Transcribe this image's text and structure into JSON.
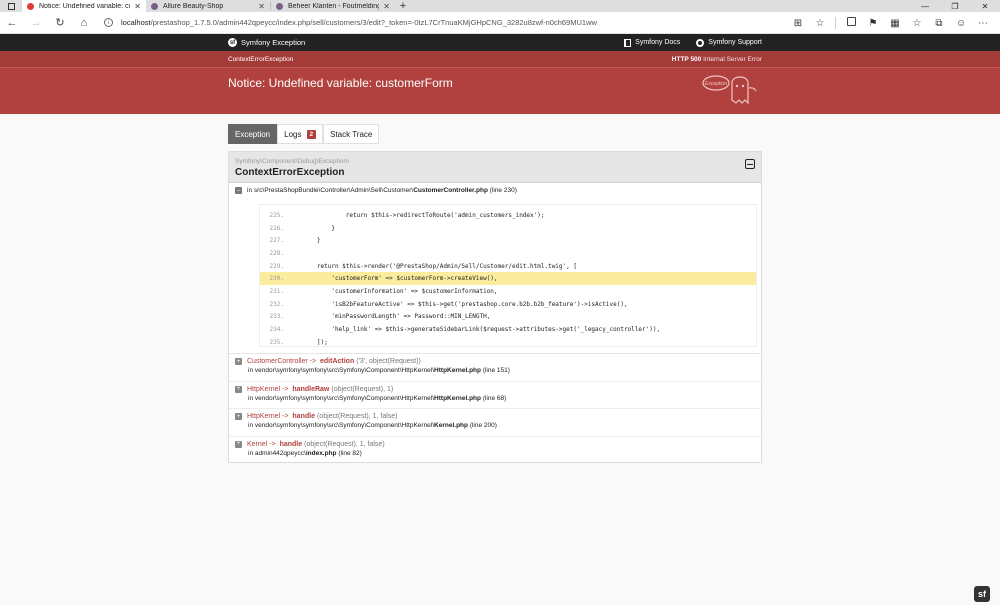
{
  "browser": {
    "tabs": [
      {
        "title": "Notice: Undefined variable: custo",
        "active": true,
        "close": "✕"
      },
      {
        "title": "Allure Beauty-Shop",
        "active": false,
        "close": "✕"
      },
      {
        "title": "Beheer Klanten - Foutmelding b",
        "active": false,
        "close": "✕"
      }
    ],
    "new_tab": "+",
    "url_host": "localhost",
    "url_path": "/prestashop_1.7.5.0/admin442qpeycc/index.php/sell/customers/3/edit?_token=-0tzL7CrTnuaKMjGHpCNG_3282u8zwf-n0ch69MU1ww"
  },
  "symfony": {
    "brand": "Symfony Exception",
    "docs_link": "Symfony Docs",
    "support_link": "Symfony Support"
  },
  "exception": {
    "class_label": "ContextErrorException",
    "status_code": "HTTP 500",
    "status_text": "Internal Server Error",
    "message": "Notice: Undefined variable: customerForm",
    "ghost_label": "Exception"
  },
  "tabs": {
    "exception": "Exception",
    "logs": "Logs",
    "logs_count": "2",
    "stack_trace": "Stack Trace"
  },
  "trace": {
    "namespace": "Symfony\\Component\\Debug\\Exception\\",
    "class": "ContextErrorException",
    "first_frame": {
      "prefix": "in src\\PrestaShopBundle\\Controller\\Admin\\Sell\\Customer\\",
      "file": "CustomerController.php",
      "line": "(line 230)"
    },
    "code_lines": [
      {
        "n": "225.",
        "code": "                return $this->redirectToRoute('admin_customers_index');",
        "hl": false
      },
      {
        "n": "226.",
        "code": "            }",
        "hl": false
      },
      {
        "n": "227.",
        "code": "        }",
        "hl": false
      },
      {
        "n": "228.",
        "code": "",
        "hl": false
      },
      {
        "n": "229.",
        "code": "        return $this->render('@PrestaShop/Admin/Sell/Customer/edit.html.twig', [",
        "hl": false
      },
      {
        "n": "230.",
        "code": "            'customerForm' => $customerForm->createView(),",
        "hl": true
      },
      {
        "n": "231.",
        "code": "            'customerInformation' => $customerInformation,",
        "hl": false
      },
      {
        "n": "232.",
        "code": "            'isB2bFeatureActive' => $this->get('prestashop.core.b2b.b2b_feature')->isActive(),",
        "hl": false
      },
      {
        "n": "233.",
        "code": "            'minPasswordLength' => Password::MIN_LENGTH,",
        "hl": false
      },
      {
        "n": "234.",
        "code": "            'help_link' => $this->generateSidebarLink($request->attributes->get('_legacy_controller')),",
        "hl": false
      },
      {
        "n": "235.",
        "code": "        ]);",
        "hl": false
      }
    ],
    "frames": [
      {
        "class": "CustomerController",
        "arrow": "->",
        "fn": "editAction",
        "args": "('3', object(Request))",
        "path": "in vendor\\symfony\\symfony\\src\\Symfony\\Component\\HttpKernel\\",
        "file": "HttpKernel.php",
        "line": "(line 151)"
      },
      {
        "class": "HttpKernel",
        "arrow": "->",
        "fn": "handleRaw",
        "args": "(object(Request), 1)",
        "path": "in vendor\\symfony\\symfony\\src\\Symfony\\Component\\HttpKernel\\",
        "file": "HttpKernel.php",
        "line": "(line 68)"
      },
      {
        "class": "HttpKernel",
        "arrow": "->",
        "fn": "handle",
        "args": "(object(Request), 1, false)",
        "path": "in vendor\\symfony\\symfony\\src\\Symfony\\Component\\HttpKernel\\",
        "file": "Kernel.php",
        "line": "(line 200)"
      },
      {
        "class": "Kernel",
        "arrow": "->",
        "fn": "handle",
        "args": "(object(Request), 1, false)",
        "path": "in admin442qpeycc\\",
        "file": "index.php",
        "line": "(line 82)"
      }
    ]
  },
  "colors": {
    "accent": "#b0413e",
    "highlight": "#fcec9d",
    "header_dark": "#222222"
  }
}
